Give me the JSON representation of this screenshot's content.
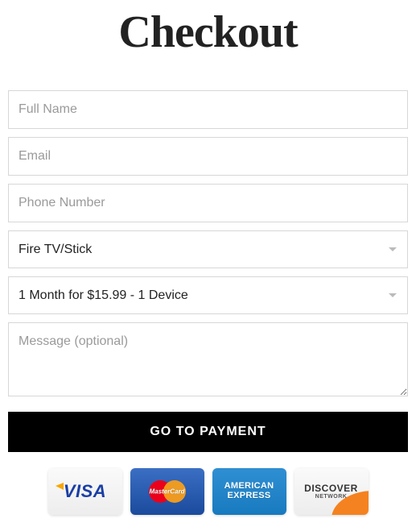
{
  "title": "Checkout",
  "fields": {
    "fullname_placeholder": "Full Name",
    "email_placeholder": "Email",
    "phone_placeholder": "Phone Number",
    "message_placeholder": "Message (optional)"
  },
  "device_select": {
    "selected": "Fire TV/Stick"
  },
  "plan_select": {
    "selected": "1 Month for $15.99 - 1 Device"
  },
  "submit_label": "GO TO PAYMENT",
  "cards": {
    "visa": "VISA",
    "mastercard": "MasterCard",
    "amex_line1": "AMERICAN",
    "amex_line2": "EXPRESS",
    "discover": "DISCOVER",
    "discover_sub": "NETWORK"
  }
}
